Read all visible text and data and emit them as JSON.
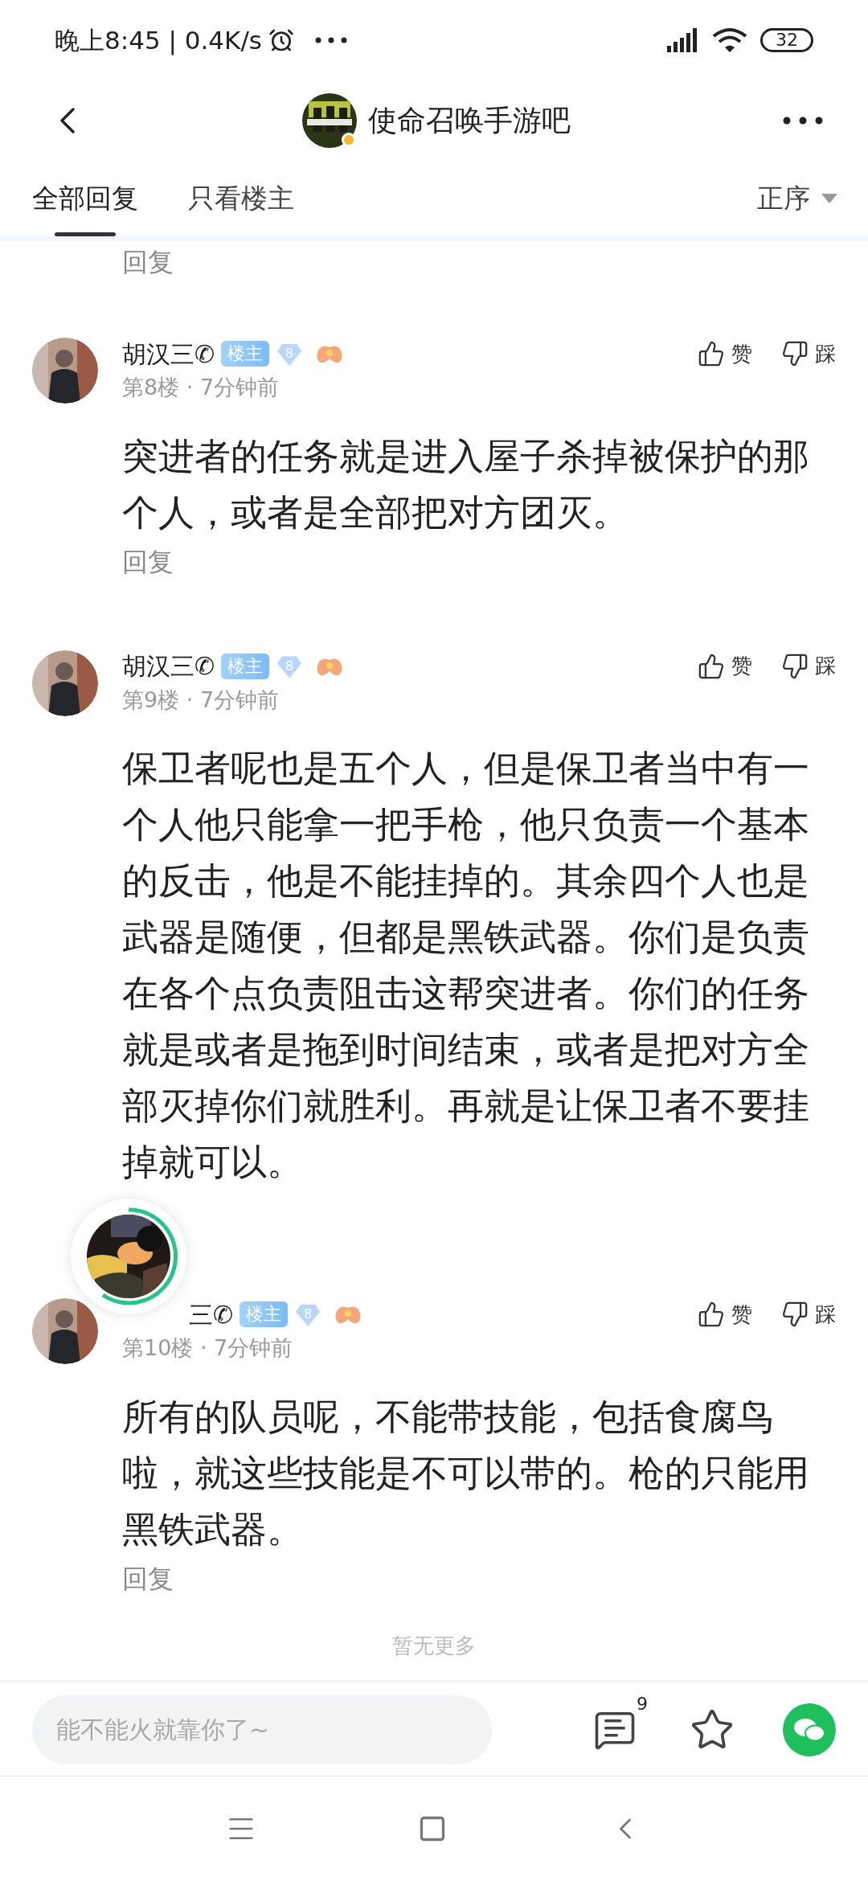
{
  "status_bar": {
    "time": "晚上8:45 | 0.4K/s",
    "battery": "32"
  },
  "nav": {
    "title": "使命召唤手游吧"
  },
  "tabs": [
    {
      "label": "全部回复",
      "selected": true
    },
    {
      "label": "只看楼主",
      "selected": false
    }
  ],
  "sort": {
    "label": "正序"
  },
  "top_reply": "回复",
  "posts": [
    {
      "name": "胡汉三✆",
      "covered": false,
      "badge": "楼主",
      "level": "8",
      "meta": "第8楼 · 7分钟前",
      "like": "赞",
      "dislike": "踩",
      "content": "突进者的任务就是进入屋子杀掉被保护的那个人，或者是全部把对方团灭。",
      "reply": "回复"
    },
    {
      "name": "胡汉三✆",
      "covered": false,
      "badge": "楼主",
      "level": "8",
      "meta": "第9楼 · 7分钟前",
      "like": "赞",
      "dislike": "踩",
      "content": "保卫者呢也是五个人，但是保卫者当中有一个人他只能拿一把手枪，他只负责一个基本的反击，他是不能挂掉的。其余四个人也是武器是随便，但都是黑铁武器。你们是负责在各个点负责阻击这帮突进者。你们的任务就是或者是拖到时间结束，或者是把对方全部灭掉你们就胜利。再就是让保卫者不要挂掉就可以。"
    },
    {
      "name": "三✆",
      "covered": true,
      "badge": "楼主",
      "level": "8",
      "meta": "第10楼 · 7分钟前",
      "like": "赞",
      "dislike": "踩",
      "content": "所有的队员呢，不能带技能，包括食腐鸟啦，就这些技能是不可以带的。枪的只能用黑铁武器。",
      "reply": "回复"
    }
  ],
  "end_text": "暂无更多",
  "comment_bar": {
    "placeholder": "能不能火就靠你了~",
    "comment_count": "9"
  }
}
